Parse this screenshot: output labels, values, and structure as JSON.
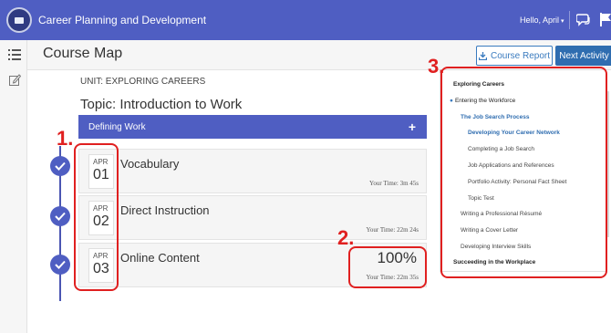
{
  "app": {
    "title": "Career Planning and Development",
    "greeting": "Hello, April",
    "greeting_caret": "▾"
  },
  "header": {
    "page_title": "Course Map",
    "course_report_label": "Course Report",
    "next_activity_label": "Next Activity"
  },
  "main": {
    "unit_label": "UNIT: EXPLORING CAREERS",
    "topic_title": "Topic: Introduction to Work",
    "section_label": "Defining Work",
    "section_plus": "+",
    "activities": [
      {
        "month": "APR",
        "day": "01",
        "title": "Vocabulary",
        "time": "Your Time: 3m 45s",
        "percent": ""
      },
      {
        "month": "APR",
        "day": "02",
        "title": "Direct Instruction",
        "time": "Your Time: 22m 24s",
        "percent": ""
      },
      {
        "month": "APR",
        "day": "03",
        "title": "Online Content",
        "time": "Your Time: 22m 35s",
        "percent": "100%"
      }
    ]
  },
  "annotations": {
    "n1": "1.",
    "n2": "2.",
    "n3": "3."
  },
  "side_panel": {
    "items": [
      "Exploring Careers",
      "Entering the Workforce",
      "The Job Search Process",
      "Developing Your Career Network",
      "Completing a Job Search",
      "Job Applications and References",
      "Portfolio Activity: Personal Fact Sheet",
      "Topic Test",
      "Writing a Professional Résumé",
      "Writing a Cover Letter",
      "Developing Interview Skills",
      "Succeeding in the Workplace"
    ]
  },
  "colors": {
    "brand": "#4f5ec2",
    "link": "#2f6db0",
    "annotation_red": "#e02020"
  },
  "icons": [
    "app-logo-icon",
    "chat-icon",
    "flag-icon",
    "list-icon",
    "edit-icon",
    "download-icon",
    "check-icon",
    "plus-icon"
  ]
}
